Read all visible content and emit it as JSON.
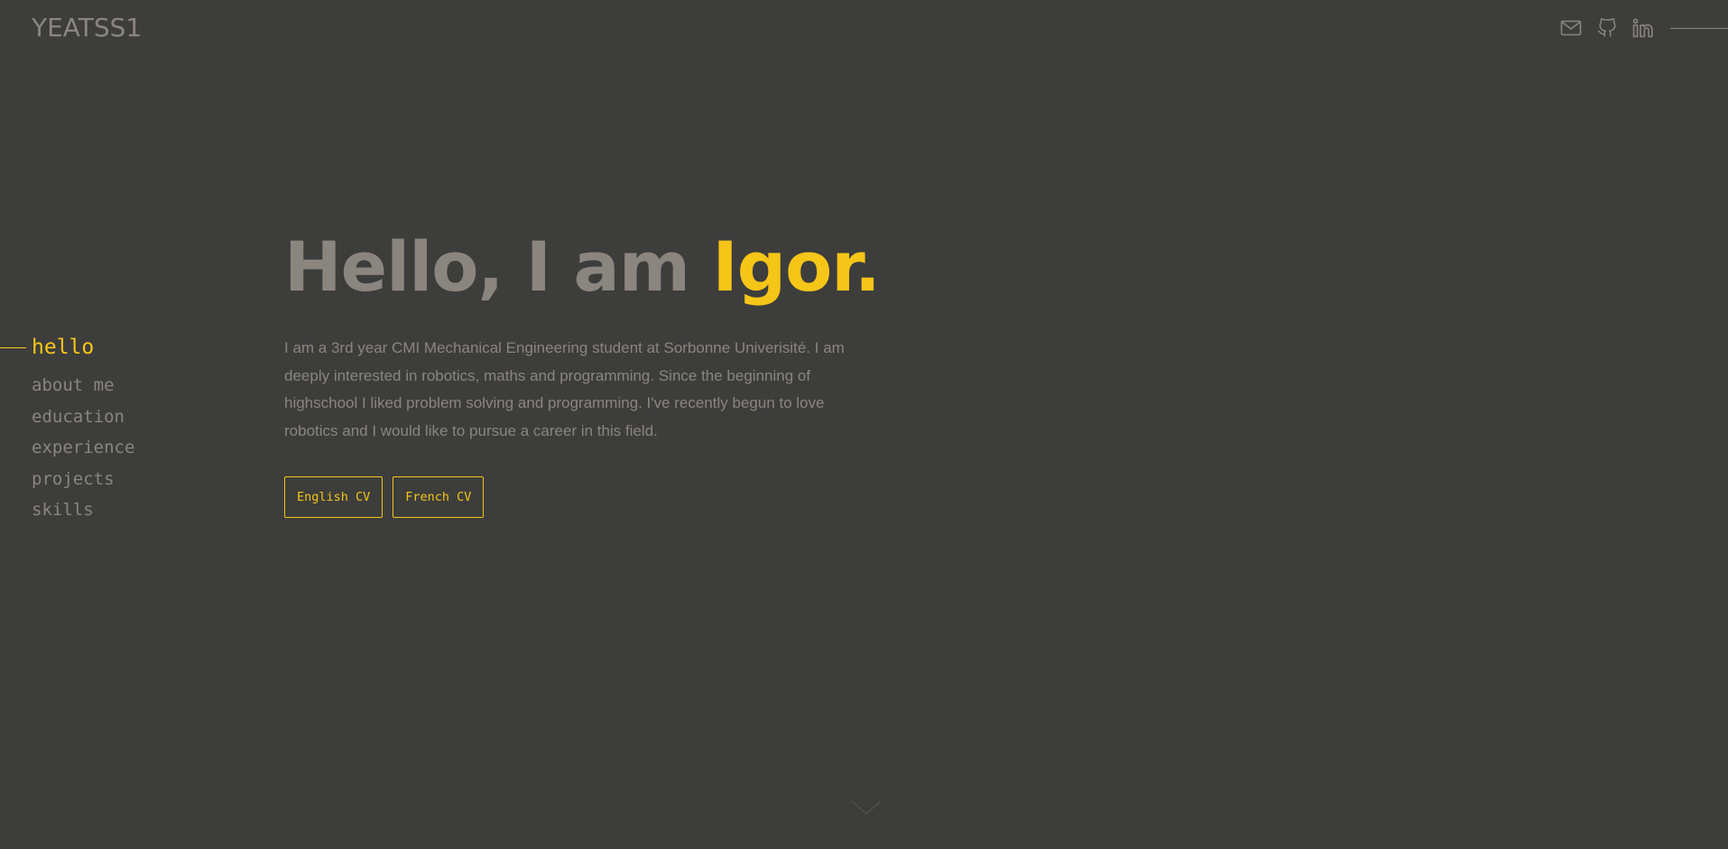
{
  "header": {
    "logo": "YEATSS1",
    "socials": [
      {
        "name": "email",
        "icon": "mail-icon"
      },
      {
        "name": "github",
        "icon": "github-icon"
      },
      {
        "name": "linkedin",
        "icon": "linkedin-icon"
      }
    ]
  },
  "nav": {
    "items": [
      {
        "label": "hello",
        "active": true
      },
      {
        "label": "about me",
        "active": false
      },
      {
        "label": "education",
        "active": false
      },
      {
        "label": "experience",
        "active": false
      },
      {
        "label": "projects",
        "active": false
      },
      {
        "label": "skills",
        "active": false
      }
    ]
  },
  "hero": {
    "greeting": "Hello, I am ",
    "name": "Igor.",
    "description": "I am a 3rd year CMI Mechanical Engineering student at Sorbonne Univerisité. I am deeply interested in robotics, maths and programming. Since the beginning of highschool I liked problem solving and programming. I've recently begun to love robotics and I would like to pursue a career in this field.",
    "buttons": {
      "english_cv": "English CV",
      "french_cv": "French CV"
    }
  },
  "scroll": {
    "icon": "chevron-down-icon"
  },
  "colors": {
    "background": "#3d3d3b",
    "accent": "#f5c518",
    "text": "#8b8580"
  }
}
